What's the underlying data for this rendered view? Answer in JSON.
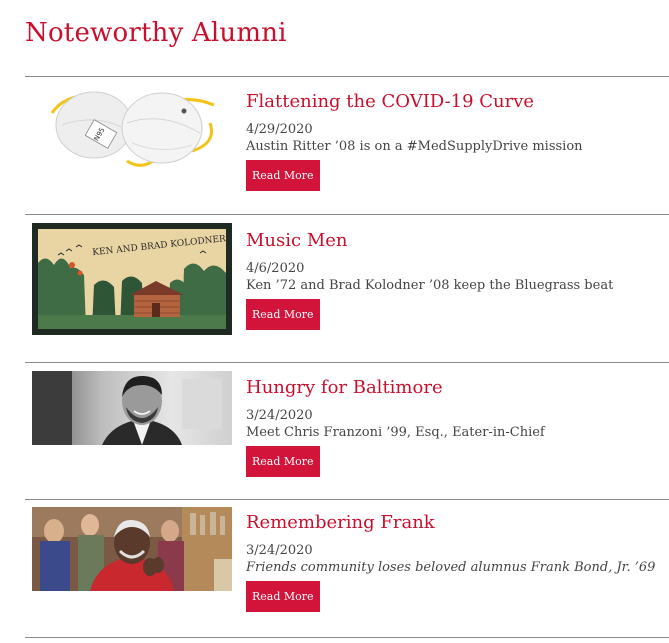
{
  "section": {
    "title": "Noteworthy Alumni"
  },
  "items": [
    {
      "headline": "Flattening the COVID-19 Curve",
      "date": "4/29/2020",
      "description": "Austin Ritter ’08 is on a #MedSupplyDrive mission",
      "button": "Read More",
      "image_text": "N95"
    },
    {
      "headline": "Music Men",
      "date": "4/6/2020",
      "description": "Ken ’72 and Brad Kolodner ’08 keep the Bluegrass beat",
      "button": "Read More",
      "image_text": "KEN AND BRAD KOLODNER"
    },
    {
      "headline": "Hungry for Baltimore",
      "date": "3/24/2020",
      "description": "Meet Chris Franzoni ’99, Esq., Eater-in-Chief",
      "button": "Read More"
    },
    {
      "headline": "Remembering Frank",
      "date": "3/24/2020",
      "description": "Friends community loses beloved alumnus Frank Bond, Jr. ’69",
      "button": "Read More"
    }
  ],
  "colors": {
    "accent": "#c8102e",
    "button": "#d2143a",
    "text": "#444444",
    "divider": "#8a8a8a"
  }
}
